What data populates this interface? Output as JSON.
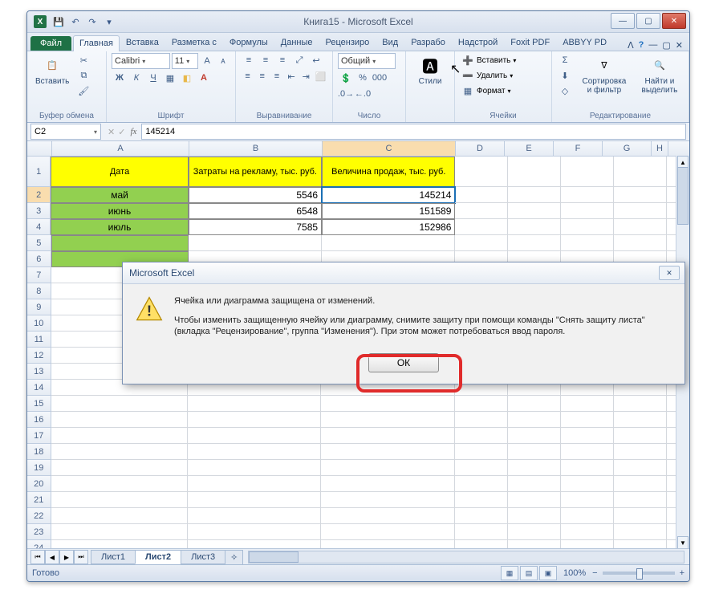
{
  "title": "Книга15  -  Microsoft Excel",
  "tabs": {
    "file": "Файл",
    "items": [
      "Главная",
      "Вставка",
      "Разметка с",
      "Формулы",
      "Данные",
      "Рецензиро",
      "Вид",
      "Разрабо",
      "Надстрой",
      "Foxit PDF",
      "ABBYY PD"
    ],
    "active_index": 0
  },
  "ribbon": {
    "clipboard": {
      "label": "Буфер обмена",
      "paste": "Вставить"
    },
    "font": {
      "label": "Шрифт",
      "name": "Calibri",
      "size": "11"
    },
    "alignment": {
      "label": "Выравнивание"
    },
    "number": {
      "label": "Число",
      "format": "Общий"
    },
    "styles": {
      "label": "",
      "btn": "Стили"
    },
    "cells": {
      "label": "Ячейки",
      "insert": "Вставить",
      "delete": "Удалить",
      "format": "Формат"
    },
    "editing": {
      "label": "Редактирование",
      "sort": "Сортировка и фильтр",
      "find": "Найти и выделить"
    }
  },
  "formula": {
    "namebox": "C2",
    "value": "145214"
  },
  "columns": [
    "A",
    "B",
    "C",
    "D",
    "E",
    "F",
    "G",
    "H"
  ],
  "sheet": {
    "headers": {
      "A": "Дата",
      "B": "Затраты на рекламу, тыс. руб.",
      "C": "Величина продаж, тыс. руб."
    },
    "rows": [
      {
        "A": "май",
        "B": "5546",
        "C": "145214"
      },
      {
        "A": "июнь",
        "B": "6548",
        "C": "151589"
      },
      {
        "A": "июль",
        "B": "7585",
        "C": "152986"
      }
    ],
    "selected": "C2"
  },
  "sheets": {
    "items": [
      "Лист1",
      "Лист2",
      "Лист3"
    ],
    "active_index": 1
  },
  "status": {
    "ready": "Готово",
    "zoom": "100%"
  },
  "dialog": {
    "title": "Microsoft Excel",
    "line1": "Ячейка или диаграмма защищена от изменений.",
    "line2": "Чтобы изменить защищенную ячейку или диаграмму, снимите защиту при помощи команды \"Снять защиту листа\" (вкладка \"Рецензирование\", группа \"Изменения\"). При этом может потребоваться ввод пароля.",
    "ok": "ОК"
  }
}
